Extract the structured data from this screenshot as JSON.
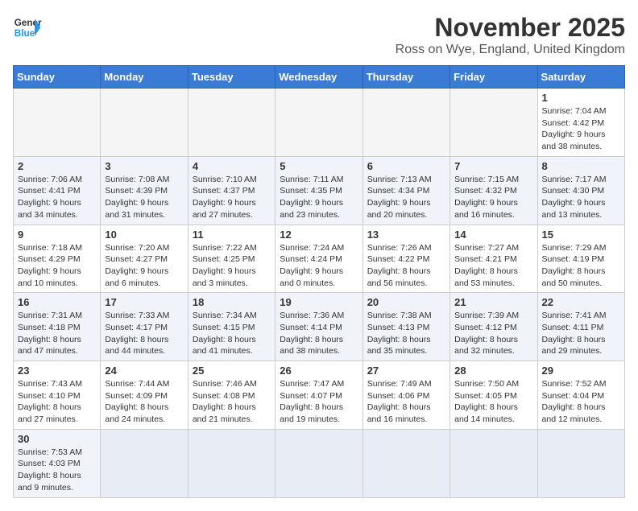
{
  "header": {
    "logo_line1": "General",
    "logo_line2": "Blue",
    "month": "November 2025",
    "location": "Ross on Wye, England, United Kingdom"
  },
  "weekdays": [
    "Sunday",
    "Monday",
    "Tuesday",
    "Wednesday",
    "Thursday",
    "Friday",
    "Saturday"
  ],
  "weeks": [
    [
      {
        "day": "",
        "info": ""
      },
      {
        "day": "",
        "info": ""
      },
      {
        "day": "",
        "info": ""
      },
      {
        "day": "",
        "info": ""
      },
      {
        "day": "",
        "info": ""
      },
      {
        "day": "",
        "info": ""
      },
      {
        "day": "1",
        "info": "Sunrise: 7:04 AM\nSunset: 4:42 PM\nDaylight: 9 hours\nand 38 minutes."
      }
    ],
    [
      {
        "day": "2",
        "info": "Sunrise: 7:06 AM\nSunset: 4:41 PM\nDaylight: 9 hours\nand 34 minutes."
      },
      {
        "day": "3",
        "info": "Sunrise: 7:08 AM\nSunset: 4:39 PM\nDaylight: 9 hours\nand 31 minutes."
      },
      {
        "day": "4",
        "info": "Sunrise: 7:10 AM\nSunset: 4:37 PM\nDaylight: 9 hours\nand 27 minutes."
      },
      {
        "day": "5",
        "info": "Sunrise: 7:11 AM\nSunset: 4:35 PM\nDaylight: 9 hours\nand 23 minutes."
      },
      {
        "day": "6",
        "info": "Sunrise: 7:13 AM\nSunset: 4:34 PM\nDaylight: 9 hours\nand 20 minutes."
      },
      {
        "day": "7",
        "info": "Sunrise: 7:15 AM\nSunset: 4:32 PM\nDaylight: 9 hours\nand 16 minutes."
      },
      {
        "day": "8",
        "info": "Sunrise: 7:17 AM\nSunset: 4:30 PM\nDaylight: 9 hours\nand 13 minutes."
      }
    ],
    [
      {
        "day": "9",
        "info": "Sunrise: 7:18 AM\nSunset: 4:29 PM\nDaylight: 9 hours\nand 10 minutes."
      },
      {
        "day": "10",
        "info": "Sunrise: 7:20 AM\nSunset: 4:27 PM\nDaylight: 9 hours\nand 6 minutes."
      },
      {
        "day": "11",
        "info": "Sunrise: 7:22 AM\nSunset: 4:25 PM\nDaylight: 9 hours\nand 3 minutes."
      },
      {
        "day": "12",
        "info": "Sunrise: 7:24 AM\nSunset: 4:24 PM\nDaylight: 9 hours\nand 0 minutes."
      },
      {
        "day": "13",
        "info": "Sunrise: 7:26 AM\nSunset: 4:22 PM\nDaylight: 8 hours\nand 56 minutes."
      },
      {
        "day": "14",
        "info": "Sunrise: 7:27 AM\nSunset: 4:21 PM\nDaylight: 8 hours\nand 53 minutes."
      },
      {
        "day": "15",
        "info": "Sunrise: 7:29 AM\nSunset: 4:19 PM\nDaylight: 8 hours\nand 50 minutes."
      }
    ],
    [
      {
        "day": "16",
        "info": "Sunrise: 7:31 AM\nSunset: 4:18 PM\nDaylight: 8 hours\nand 47 minutes."
      },
      {
        "day": "17",
        "info": "Sunrise: 7:33 AM\nSunset: 4:17 PM\nDaylight: 8 hours\nand 44 minutes."
      },
      {
        "day": "18",
        "info": "Sunrise: 7:34 AM\nSunset: 4:15 PM\nDaylight: 8 hours\nand 41 minutes."
      },
      {
        "day": "19",
        "info": "Sunrise: 7:36 AM\nSunset: 4:14 PM\nDaylight: 8 hours\nand 38 minutes."
      },
      {
        "day": "20",
        "info": "Sunrise: 7:38 AM\nSunset: 4:13 PM\nDaylight: 8 hours\nand 35 minutes."
      },
      {
        "day": "21",
        "info": "Sunrise: 7:39 AM\nSunset: 4:12 PM\nDaylight: 8 hours\nand 32 minutes."
      },
      {
        "day": "22",
        "info": "Sunrise: 7:41 AM\nSunset: 4:11 PM\nDaylight: 8 hours\nand 29 minutes."
      }
    ],
    [
      {
        "day": "23",
        "info": "Sunrise: 7:43 AM\nSunset: 4:10 PM\nDaylight: 8 hours\nand 27 minutes."
      },
      {
        "day": "24",
        "info": "Sunrise: 7:44 AM\nSunset: 4:09 PM\nDaylight: 8 hours\nand 24 minutes."
      },
      {
        "day": "25",
        "info": "Sunrise: 7:46 AM\nSunset: 4:08 PM\nDaylight: 8 hours\nand 21 minutes."
      },
      {
        "day": "26",
        "info": "Sunrise: 7:47 AM\nSunset: 4:07 PM\nDaylight: 8 hours\nand 19 minutes."
      },
      {
        "day": "27",
        "info": "Sunrise: 7:49 AM\nSunset: 4:06 PM\nDaylight: 8 hours\nand 16 minutes."
      },
      {
        "day": "28",
        "info": "Sunrise: 7:50 AM\nSunset: 4:05 PM\nDaylight: 8 hours\nand 14 minutes."
      },
      {
        "day": "29",
        "info": "Sunrise: 7:52 AM\nSunset: 4:04 PM\nDaylight: 8 hours\nand 12 minutes."
      }
    ],
    [
      {
        "day": "30",
        "info": "Sunrise: 7:53 AM\nSunset: 4:03 PM\nDaylight: 8 hours\nand 9 minutes."
      },
      {
        "day": "",
        "info": ""
      },
      {
        "day": "",
        "info": ""
      },
      {
        "day": "",
        "info": ""
      },
      {
        "day": "",
        "info": ""
      },
      {
        "day": "",
        "info": ""
      },
      {
        "day": "",
        "info": ""
      }
    ]
  ]
}
